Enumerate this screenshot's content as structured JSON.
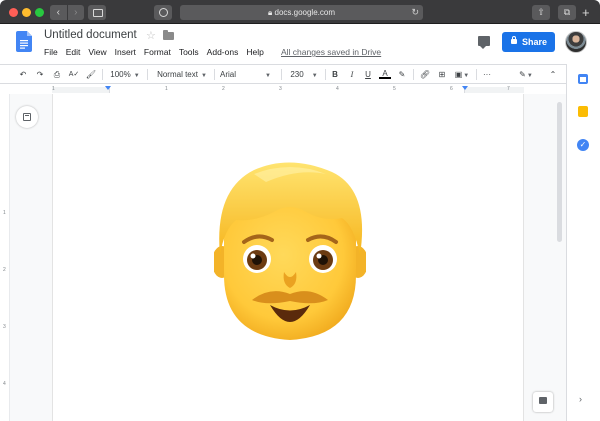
{
  "browser": {
    "url": "docs.google.com",
    "back_label": "‹",
    "forward_label": "›",
    "newtab_label": "+"
  },
  "document": {
    "title": "Untitled document",
    "menu": [
      "File",
      "Edit",
      "View",
      "Insert",
      "Format",
      "Tools",
      "Add-ons",
      "Help"
    ],
    "save_status": "All changes saved in Drive",
    "share_label": "Share"
  },
  "toolbar": {
    "zoom": "100%",
    "style": "Normal text",
    "font": "Arial",
    "font_size": "230",
    "bold": "B",
    "italic": "I",
    "underline": "U",
    "text_color": "A",
    "more": "···"
  },
  "ruler": {
    "horizontal": [
      "1",
      "1",
      "2",
      "3",
      "4",
      "5",
      "6",
      "7"
    ],
    "vertical": [
      "1",
      "2",
      "3",
      "4"
    ]
  },
  "colors": {
    "accent": "#1a73e8",
    "docs_blue": "#4285f4",
    "keep_yellow": "#fbbc04"
  },
  "content": {
    "image_icon": "man-emoji-icon"
  }
}
